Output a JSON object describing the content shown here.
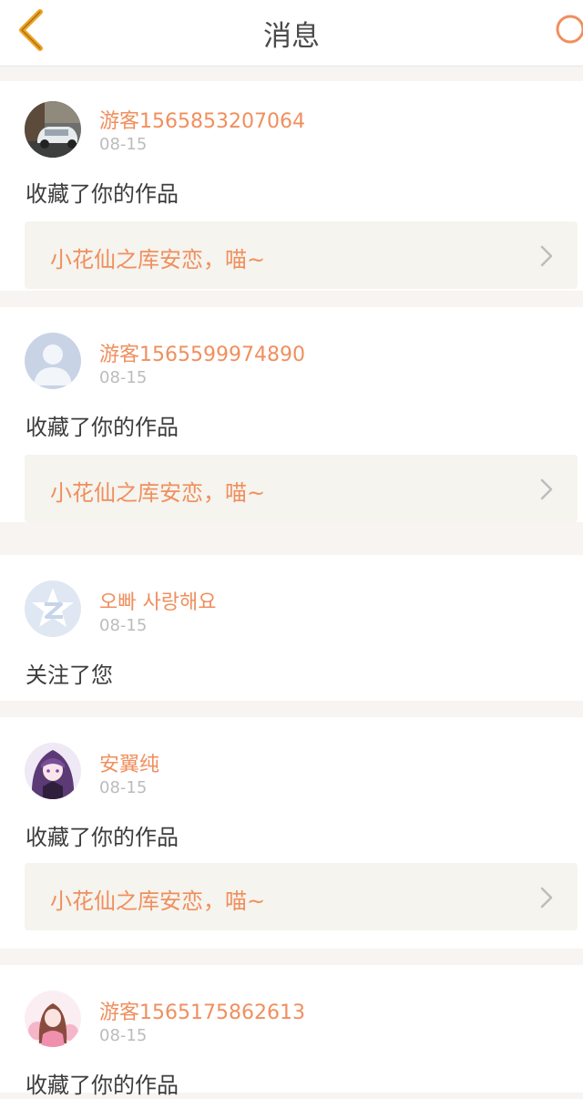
{
  "header": {
    "title": "消息",
    "back_icon": "chevron-left-icon",
    "search_icon": "search-icon"
  },
  "colors": {
    "accent": "#f08f5e",
    "back_icon": "#f1a320",
    "work_box_bg": "#f5f4ee",
    "page_bg": "#f7f4f1"
  },
  "notifications": [
    {
      "user": "游客1565853207064",
      "date": "08-15",
      "action": "收藏了你的作品",
      "work_title": "小花仙之库安恋，喵~",
      "avatar": "car-photo"
    },
    {
      "user": "游客1565599974890",
      "date": "08-15",
      "action": "收藏了你的作品",
      "work_title": "小花仙之库安恋，喵~",
      "avatar": "default-user"
    },
    {
      "user": "오빠 사랑해요",
      "date": "08-15",
      "action": "关注了您",
      "avatar": "qzone-logo"
    },
    {
      "user": "安翼纯",
      "date": "08-15",
      "action": "收藏了你的作品",
      "work_title": "小花仙之库安恋，喵~",
      "avatar": "anime-girl-purple"
    },
    {
      "user": "游客1565175862613",
      "date": "08-15",
      "action": "收藏了你的作品",
      "avatar": "anime-girl-pink"
    }
  ]
}
